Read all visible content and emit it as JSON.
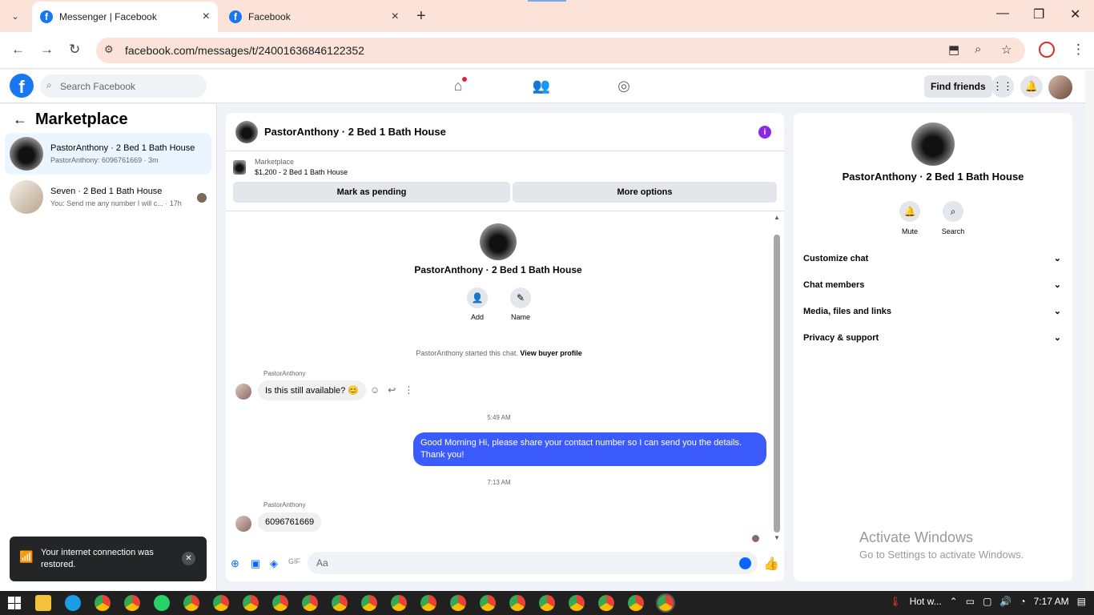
{
  "browser": {
    "tabs": [
      {
        "title": "Messenger | Facebook",
        "active": true
      },
      {
        "title": "Facebook",
        "active": false
      }
    ],
    "url": "facebook.com/messages/t/24001636846122352"
  },
  "fb_nav": {
    "search_placeholder": "Search Facebook",
    "find_friends": "Find friends"
  },
  "sidebar": {
    "title": "Marketplace",
    "conversations": [
      {
        "title": "PastorAnthony · 2 Bed 1 Bath House",
        "preview": "PastorAnthony: 6096761669 · 3m"
      },
      {
        "title": "Seven · 2 Bed 1 Bath House",
        "preview": "You: Send me any number I will c... · 17h"
      }
    ]
  },
  "toast": {
    "text": "Your internet connection was restored."
  },
  "chat": {
    "header_name": "PastorAnthony · 2 Bed 1 Bath House",
    "listing_label": "Marketplace",
    "listing_detail": "$1,200 - 2 Bed 1 Bath House",
    "mark_pending": "Mark as pending",
    "more_options": "More options",
    "intro_name": "PastorAnthony · 2 Bed 1 Bath House",
    "add_label": "Add",
    "name_label": "Name",
    "system_text": "PastorAnthony started this chat.",
    "system_link": "View buyer profile",
    "messages": [
      {
        "sender": "PastorAnthony",
        "text": "Is this still available? 😊"
      },
      {
        "time": "5:49 AM"
      },
      {
        "text": "Good Morning Hi, please share your contact number so I can send you the details. Thank you!"
      },
      {
        "time": "7:13 AM"
      },
      {
        "sender": "PastorAnthony",
        "text": "6096761669"
      }
    ],
    "composer_placeholder": "Aa"
  },
  "right_panel": {
    "name": "PastorAnthony · 2 Bed 1 Bath House",
    "mute": "Mute",
    "search": "Search",
    "sections": [
      "Customize chat",
      "Chat members",
      "Media, files and links",
      "Privacy & support"
    ]
  },
  "watermark": {
    "line1": "Activate Windows",
    "line2": "Go to Settings to activate Windows."
  },
  "taskbar": {
    "weather": "Hot w...",
    "time": "7:17 AM"
  },
  "colors": {
    "fb_blue": "#1877f2",
    "outgoing_bubble": "#3b5bfd",
    "selected_conv": "#ebf5ff"
  }
}
